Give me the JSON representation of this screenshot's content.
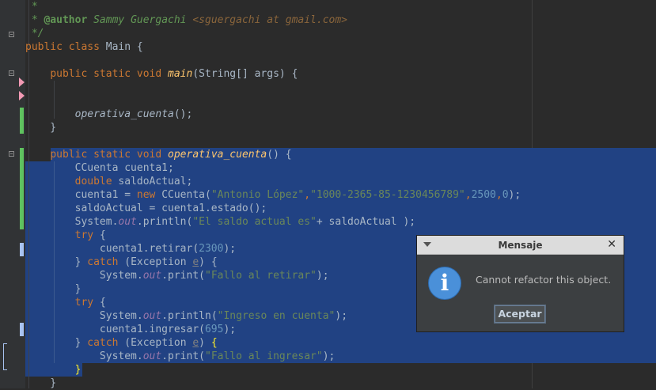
{
  "code": {
    "lines": [
      [
        {
          "c": "cmt",
          "t": " *"
        }
      ],
      [
        {
          "c": "cmt",
          "t": " * "
        },
        {
          "c": "cmtag",
          "t": "@author"
        },
        {
          "c": "cmt",
          "t": " Sammy Guergachi "
        },
        {
          "c": "cmlink",
          "t": "<sguergachi at gmail.com>"
        }
      ],
      [
        {
          "c": "cmt",
          "t": " */"
        }
      ],
      [
        {
          "c": "kw",
          "t": "public class "
        },
        {
          "c": "tx",
          "t": "Main {"
        }
      ],
      [],
      [
        {
          "c": "tx",
          "t": "    "
        },
        {
          "c": "kw",
          "t": "public static void "
        },
        {
          "c": "fn",
          "t": "main"
        },
        {
          "c": "tx",
          "t": "(String[] args) {"
        }
      ],
      [],
      [],
      [
        {
          "c": "tx",
          "t": "        "
        },
        {
          "c": "tx it",
          "t": "operativa_cuenta"
        },
        {
          "c": "tx",
          "t": "();"
        }
      ],
      [
        {
          "c": "tx",
          "t": "    }"
        }
      ],
      [],
      [
        {
          "c": "tx",
          "t": "    "
        },
        {
          "c": "kw",
          "t": "public static void "
        },
        {
          "c": "fn",
          "t": "operativa_cuenta"
        },
        {
          "c": "tx",
          "t": "() {"
        }
      ],
      [
        {
          "c": "tx",
          "t": "        CCuenta cuenta1;"
        }
      ],
      [
        {
          "c": "tx",
          "t": "        "
        },
        {
          "c": "kw",
          "t": "double "
        },
        {
          "c": "tx",
          "t": "saldoActual;"
        }
      ],
      [
        {
          "c": "tx",
          "t": "        cuenta1 = "
        },
        {
          "c": "kw",
          "t": "new "
        },
        {
          "c": "tx",
          "t": "CCuenta("
        },
        {
          "c": "str",
          "t": "\"Antonio López\""
        },
        {
          "c": "kw",
          "t": ","
        },
        {
          "c": "str",
          "t": "\"1000-2365-85-1230456789\""
        },
        {
          "c": "kw",
          "t": ","
        },
        {
          "c": "num",
          "t": "2500"
        },
        {
          "c": "kw",
          "t": ","
        },
        {
          "c": "num",
          "t": "0"
        },
        {
          "c": "tx",
          "t": ");"
        }
      ],
      [
        {
          "c": "tx",
          "t": "        saldoActual = cuenta1.estado();"
        }
      ],
      [
        {
          "c": "tx",
          "t": "        System."
        },
        {
          "c": "fld",
          "t": "out"
        },
        {
          "c": "tx",
          "t": ".println("
        },
        {
          "c": "str",
          "t": "\"El saldo actual es\""
        },
        {
          "c": "tx",
          "t": "+ saldoActual );"
        }
      ],
      [
        {
          "c": "tx",
          "t": "        "
        },
        {
          "c": "kw",
          "t": "try "
        },
        {
          "c": "tx",
          "t": "{"
        }
      ],
      [
        {
          "c": "tx",
          "t": "            cuenta1.retirar("
        },
        {
          "c": "num",
          "t": "2300"
        },
        {
          "c": "tx",
          "t": ");"
        }
      ],
      [
        {
          "c": "tx",
          "t": "        } "
        },
        {
          "c": "kw",
          "t": "catch "
        },
        {
          "c": "tx",
          "t": "(Exception "
        },
        {
          "c": "unused",
          "t": "e"
        },
        {
          "c": "tx",
          "t": ") {"
        }
      ],
      [
        {
          "c": "tx",
          "t": "            System."
        },
        {
          "c": "fld",
          "t": "out"
        },
        {
          "c": "tx",
          "t": ".print("
        },
        {
          "c": "str",
          "t": "\"Fallo al retirar\""
        },
        {
          "c": "tx",
          "t": ");"
        }
      ],
      [
        {
          "c": "tx",
          "t": "        }"
        }
      ],
      [
        {
          "c": "tx",
          "t": "        "
        },
        {
          "c": "kw",
          "t": "try "
        },
        {
          "c": "tx",
          "t": "{"
        }
      ],
      [
        {
          "c": "tx",
          "t": "            System."
        },
        {
          "c": "fld",
          "t": "out"
        },
        {
          "c": "tx",
          "t": ".println("
        },
        {
          "c": "str",
          "t": "\"Ingreso en cuenta\""
        },
        {
          "c": "tx",
          "t": ");"
        }
      ],
      [
        {
          "c": "tx",
          "t": "            cuenta1.ingresar("
        },
        {
          "c": "num",
          "t": "695"
        },
        {
          "c": "tx",
          "t": ");"
        }
      ],
      [
        {
          "c": "tx",
          "t": "        } "
        },
        {
          "c": "kw",
          "t": "catch "
        },
        {
          "c": "tx",
          "t": "(Exception "
        },
        {
          "c": "unused",
          "t": "e"
        },
        {
          "c": "tx",
          "t": ") "
        },
        {
          "c": "br",
          "t": "{"
        }
      ],
      [
        {
          "c": "tx",
          "t": "            System."
        },
        {
          "c": "fld",
          "t": "out"
        },
        {
          "c": "tx",
          "t": ".print("
        },
        {
          "c": "str",
          "t": "\"Fallo al ingresar\""
        },
        {
          "c": "tx",
          "t": ");"
        }
      ],
      [
        {
          "c": "tx",
          "t": "        "
        },
        {
          "c": "br",
          "t": "}"
        }
      ],
      [
        {
          "c": "tx",
          "t": "    }"
        }
      ]
    ]
  },
  "dialog": {
    "title": "Mensaje",
    "close_glyph": "✕",
    "icon": "info-icon",
    "icon_glyph": "i",
    "message": "Cannot refactor this object.",
    "button_label": "Aceptar"
  },
  "colors": {
    "editor_bg": "#2b2b2b",
    "selection": "#214283",
    "keyword": "#cc7832",
    "string": "#6a8759",
    "number": "#6897bb",
    "method_decl": "#ffc66d"
  }
}
